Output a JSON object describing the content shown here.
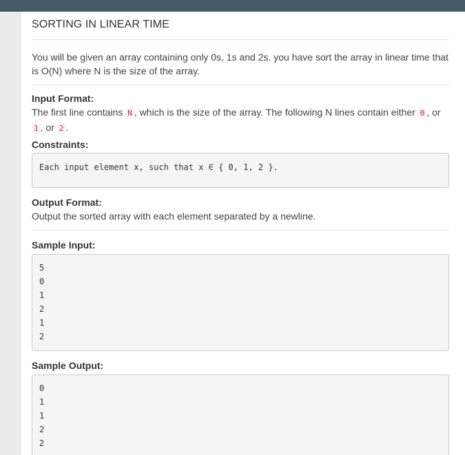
{
  "problem": {
    "title": "SORTING IN LINEAR TIME",
    "description": "You will be given an array containing only 0s, 1s and 2s. you have sort the array in linear time that is O(N) where N is the size of the array.",
    "input_format": {
      "heading": "Input Format:",
      "text_1": "The first line contains ",
      "code_n": "N",
      "text_2": ", which is the size of the array. The following N lines contain either ",
      "code_0": "0",
      "sep_1": ", or ",
      "code_1": "1",
      "sep_2": ", or ",
      "code_2": "2",
      "end": "."
    },
    "constraints": {
      "heading": "Constraints:",
      "text": "Each input element x, such that x ∈ { 0, 1, 2 }."
    },
    "output_format": {
      "heading": "Output Format:",
      "text": "Output the sorted array with each element separated by a newline."
    },
    "sample_input": {
      "heading": "Sample Input:",
      "lines": [
        "5",
        "0",
        "1",
        "2",
        "1",
        "2"
      ]
    },
    "sample_output": {
      "heading": "Sample Output:",
      "lines": [
        "0",
        "1",
        "1",
        "2",
        "2"
      ]
    }
  },
  "colors": {
    "topbar": "#455a64",
    "inline_code": "#c7254e",
    "inline_code_bg": "#f9f2f4",
    "code_block_bg": "#f5f5f5"
  }
}
